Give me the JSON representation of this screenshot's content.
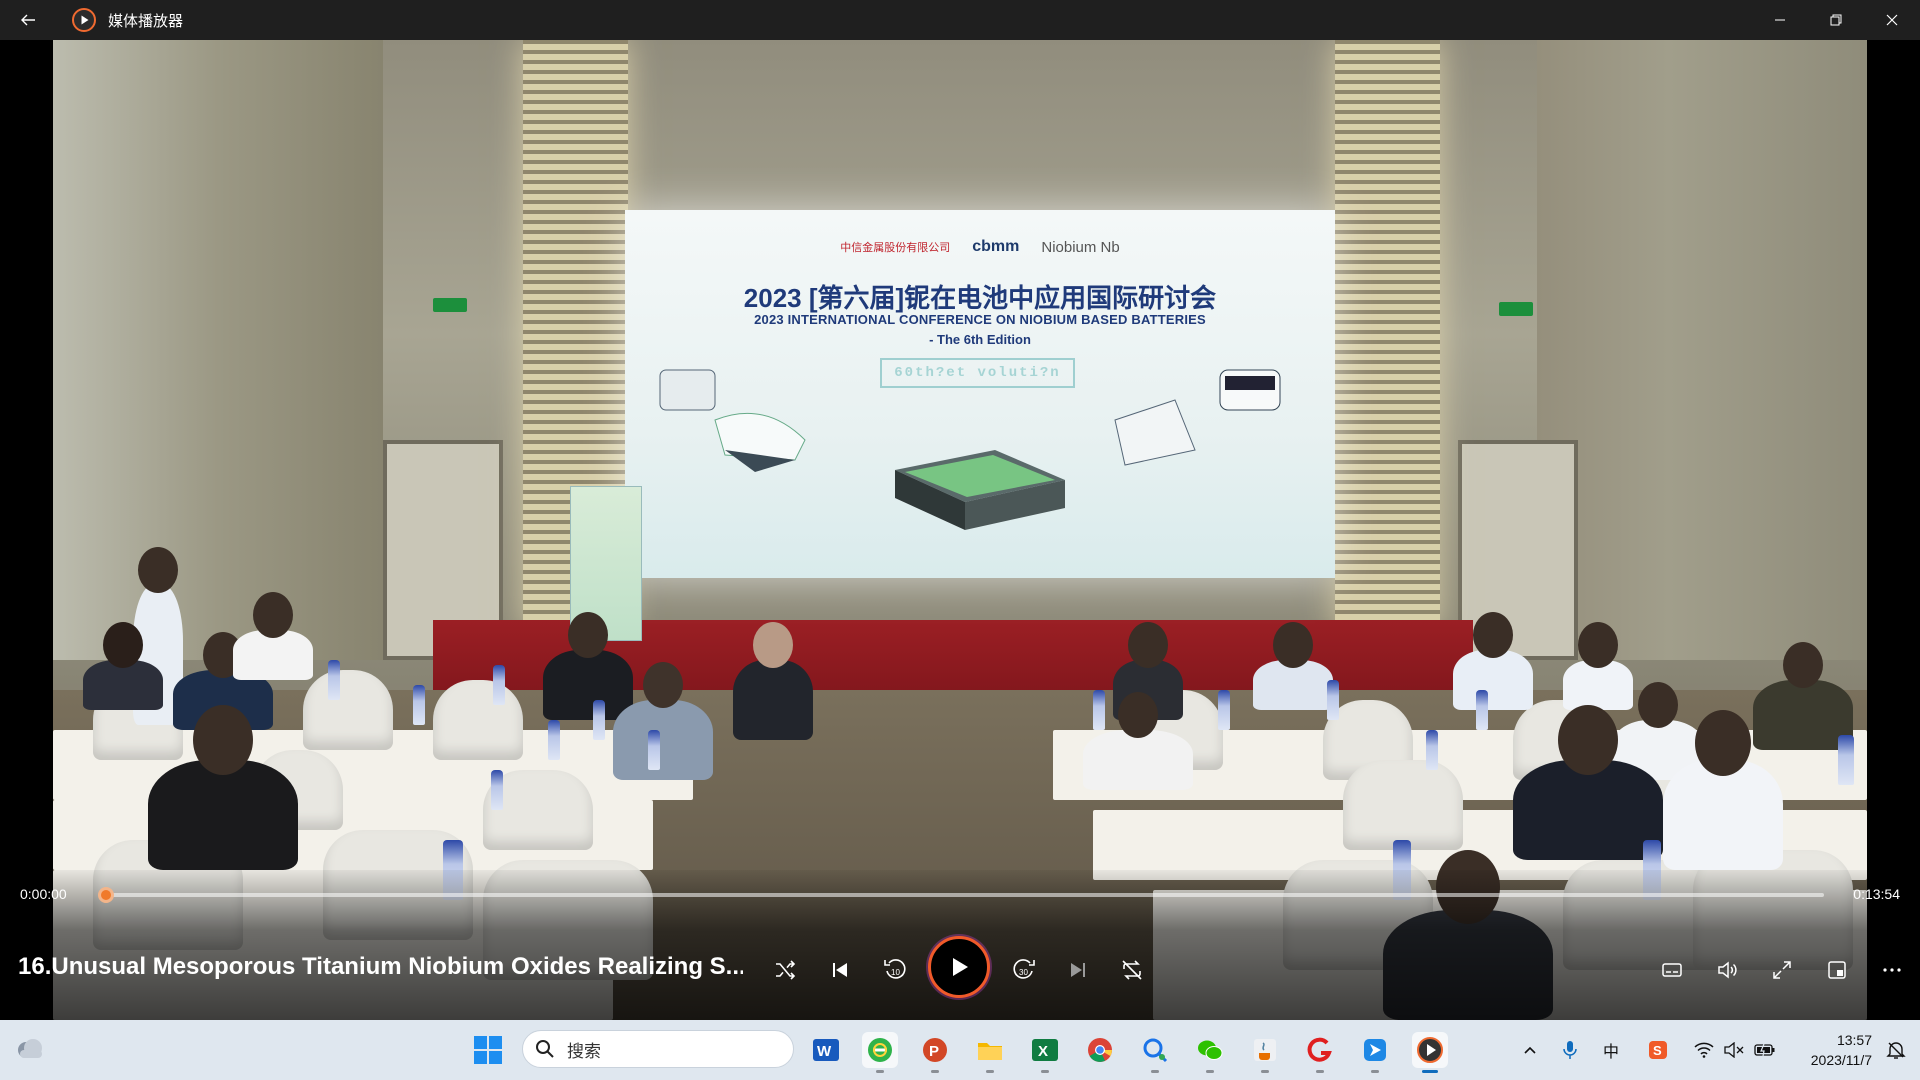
{
  "window": {
    "title": "媒体播放器"
  },
  "video_frame": {
    "slide": {
      "logo_left": "中信金属股份有限公司",
      "logo_middle": "cbmm",
      "logo_right": "Niobium Nb",
      "title_cn": "2023 [第六届]铌在电池中应用国际研讨会",
      "title_en": "2023 INTERNATIONAL CONFERENCE ON NIOBIUM BASED BATTERIES",
      "edition": "- The 6th Edition",
      "box_text": "60th?et voluti?n"
    }
  },
  "player": {
    "current_time": "0:00:00",
    "total_time": "0:13:54",
    "progress": 0.0,
    "media_title": "16.Unusual Mesoporous Titanium Niobium Oxides Realizing S...",
    "accent_color": "#f07a2a"
  },
  "taskbar": {
    "search_placeholder": "搜索",
    "ime_label": "中",
    "time": "13:57",
    "date": "2023/11/7"
  }
}
